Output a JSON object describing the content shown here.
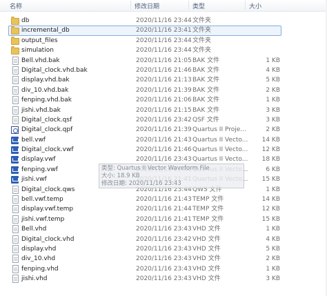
{
  "header": {
    "name": "名称",
    "date": "修改日期",
    "type": "类型",
    "size": "大小"
  },
  "files": [
    {
      "name": "db",
      "date": "2020/11/16 23:44",
      "type": "文件夹",
      "size": "",
      "icon": "folder-icon"
    },
    {
      "name": "incremental_db",
      "date": "2020/11/16 23:41",
      "type": "文件夹",
      "size": "",
      "icon": "folder-icon"
    },
    {
      "name": "output_files",
      "date": "2020/11/16 23:44",
      "type": "文件夹",
      "size": "",
      "icon": "folder-icon"
    },
    {
      "name": "simulation",
      "date": "2020/11/16 23:44",
      "type": "文件夹",
      "size": "",
      "icon": "folder-icon"
    },
    {
      "name": "Bell.vhd.bak",
      "date": "2020/11/16 21:05",
      "type": "BAK 文件",
      "size": "1 KB",
      "icon": "document-icon"
    },
    {
      "name": "Digital_clock.vhd.bak",
      "date": "2020/11/16 21:46",
      "type": "BAK 文件",
      "size": "4 KB",
      "icon": "document-icon"
    },
    {
      "name": "display.vhd.bak",
      "date": "2020/11/16 21:13",
      "type": "BAK 文件",
      "size": "5 KB",
      "icon": "document-icon"
    },
    {
      "name": "div_10.vhd.bak",
      "date": "2020/11/16 21:39",
      "type": "BAK 文件",
      "size": "2 KB",
      "icon": "document-icon"
    },
    {
      "name": "fenping.vhd.bak",
      "date": "2020/11/16 21:06",
      "type": "BAK 文件",
      "size": "1 KB",
      "icon": "document-icon"
    },
    {
      "name": "jishi.vhd.bak",
      "date": "2020/11/16 21:15",
      "type": "BAK 文件",
      "size": "3 KB",
      "icon": "document-icon"
    },
    {
      "name": "Digital_clock.qsf",
      "date": "2020/11/16 23:42",
      "type": "QSF 文件",
      "size": "3 KB",
      "icon": "document-icon"
    },
    {
      "name": "Digital_clock.qpf",
      "date": "2020/11/16 21:39",
      "type": "Quartus II Proje...",
      "size": "2 KB",
      "icon": "quartus-project-icon"
    },
    {
      "name": "bell.vwf",
      "date": "2020/11/16 21:43",
      "type": "Quartus II Vecto...",
      "size": "14 KB",
      "icon": "waveform-icon"
    },
    {
      "name": "Digital_clock.vwf",
      "date": "2020/11/16 21:46",
      "type": "Quartus II Vecto...",
      "size": "12 KB",
      "icon": "waveform-icon"
    },
    {
      "name": "display.vwf",
      "date": "2020/11/16 23:43",
      "type": "Quartus II Vecto...",
      "size": "18 KB",
      "icon": "waveform-icon"
    },
    {
      "name": "fenping.vwf",
      "date": "2020/11/16 21:48",
      "type": "Quartus II Vecto...",
      "size": "6 KB",
      "icon": "waveform-icon"
    },
    {
      "name": "jishi.vwf",
      "date": "2020/11/16 21:41",
      "type": "Quartus II Vecto...",
      "size": "15 KB",
      "icon": "waveform-icon"
    },
    {
      "name": "Digital_clock.qws",
      "date": "2020/11/16 23:44",
      "type": "QWS 文件",
      "size": "1 KB",
      "icon": "document-icon"
    },
    {
      "name": "bell.vwf.temp",
      "date": "2020/11/16 21:43",
      "type": "TEMP 文件",
      "size": "14 KB",
      "icon": "document-icon"
    },
    {
      "name": "display.vwf.temp",
      "date": "2020/11/16 21:44",
      "type": "TEMP 文件",
      "size": "12 KB",
      "icon": "document-icon"
    },
    {
      "name": "jishi.vwf.temp",
      "date": "2020/11/16 21:41",
      "type": "TEMP 文件",
      "size": "15 KB",
      "icon": "document-icon"
    },
    {
      "name": "Bell.vhd",
      "date": "2020/11/16 23:43",
      "type": "VHD 文件",
      "size": "1 KB",
      "icon": "document-icon"
    },
    {
      "name": "Digital_clock.vhd",
      "date": "2020/11/16 23:42",
      "type": "VHD 文件",
      "size": "4 KB",
      "icon": "document-icon"
    },
    {
      "name": "display.vhd",
      "date": "2020/11/16 23:43",
      "type": "VHD 文件",
      "size": "5 KB",
      "icon": "document-icon"
    },
    {
      "name": "div_10.vhd",
      "date": "2020/11/16 23:43",
      "type": "VHD 文件",
      "size": "2 KB",
      "icon": "document-icon"
    },
    {
      "name": "fenping.vhd",
      "date": "2020/11/16 23:43",
      "type": "VHD 文件",
      "size": "1 KB",
      "icon": "document-icon"
    },
    {
      "name": "jishi.vhd",
      "date": "2020/11/16 23:43",
      "type": "VHD 文件",
      "size": "3 KB",
      "icon": "document-icon"
    }
  ],
  "selected_index": 1,
  "tooltip": {
    "type_line": "类型: Quartus II Vector Waveform File",
    "size_line": "大小: 18.9 KB",
    "date_line": "修改日期: 2020/11/16 23:43"
  }
}
